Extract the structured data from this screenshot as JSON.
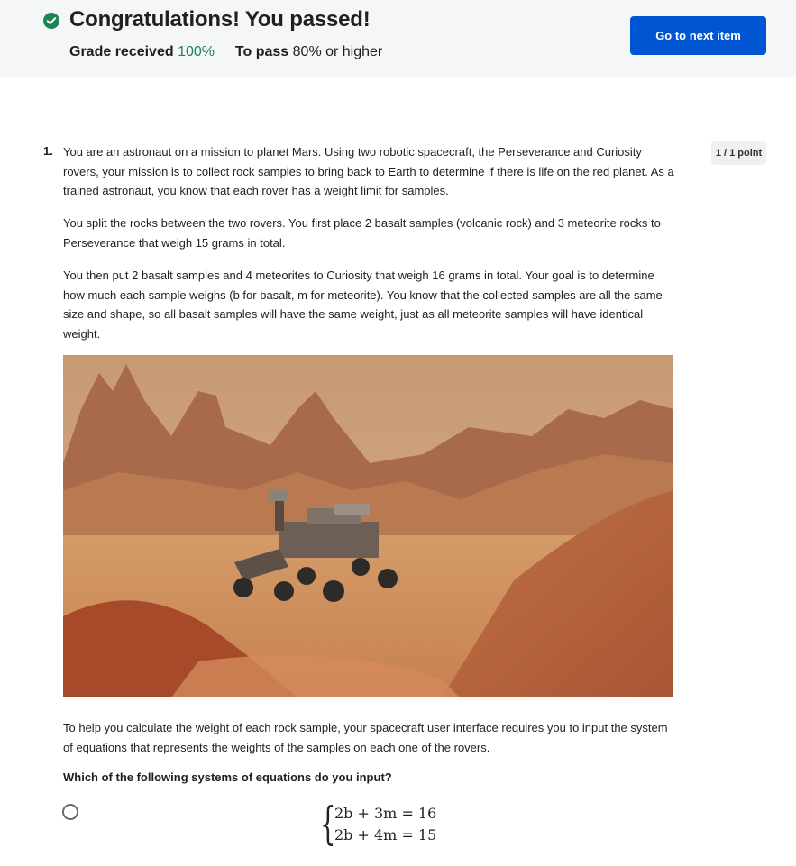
{
  "banner": {
    "title": "Congratulations! You passed!",
    "grade_label": "Grade received",
    "grade_value": "100%",
    "pass_label": "To pass",
    "pass_value": "80% or higher",
    "next_button": "Go to next item",
    "check_icon": "check-circle-icon",
    "accent_color": "#0056d2",
    "success_color": "#1f8354"
  },
  "question": {
    "number": "1.",
    "points": "1 / 1 point",
    "paragraphs": [
      "You are an astronaut on a mission to planet Mars. Using two robotic spacecraft, the Perseverance and Curiosity rovers, your mission is to collect rock samples to bring back to Earth to determine if there is life on the red planet. As a trained astronaut, you know that each rover has a weight limit for samples.",
      "You split the rocks between the two rovers. You first place 2 basalt samples (volcanic rock) and 3 meteorite rocks to Perseverance that weigh 15 grams in total.",
      "You then put 2 basalt samples and 4 meteorites to Curiosity that weigh 16 grams in total. Your goal is to determine how much each sample weighs (b for basalt, m for meteorite). You know that the collected samples are all the same size and shape, so all basalt samples will have the same weight, just as all meteorite samples will have identical weight.",
      "To help you calculate the weight of each rock sample, your spacecraft user interface requires you to input the system of equations that represents the weights of the samples on each one of the rovers."
    ],
    "prompt": "Which of the following systems of equations do you input?",
    "options": [
      {
        "equations": [
          "2b + 3m = 16",
          "2b + 4m = 15"
        ],
        "selected": false
      }
    ]
  }
}
